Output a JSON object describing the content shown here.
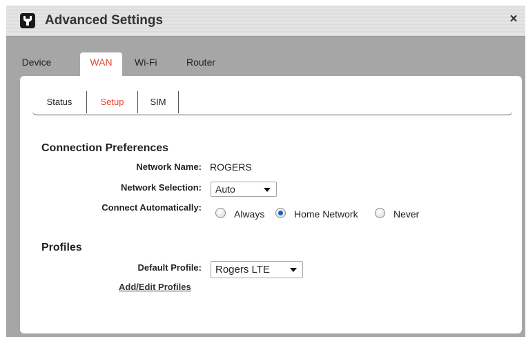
{
  "window": {
    "title": "Advanced Settings",
    "close_symbol": "×",
    "icon": "wrench-icon"
  },
  "main_tabs": [
    {
      "label": "Device",
      "active": false
    },
    {
      "label": "WAN",
      "active": true
    },
    {
      "label": "Wi-Fi",
      "active": false
    },
    {
      "label": "Router",
      "active": false
    }
  ],
  "sub_tabs": [
    {
      "label": "Status",
      "active": false
    },
    {
      "label": "Setup",
      "active": true
    },
    {
      "label": "SIM",
      "active": false
    }
  ],
  "connection_preferences": {
    "title": "Connection Preferences",
    "network_name_label": "Network Name:",
    "network_name_value": "ROGERS",
    "network_selection_label": "Network Selection:",
    "network_selection_value": "Auto",
    "connect_auto_label": "Connect Automatically:",
    "connect_options": [
      {
        "label": "Always",
        "checked": false
      },
      {
        "label": "Home Network",
        "checked": true
      },
      {
        "label": "Never",
        "checked": false
      }
    ]
  },
  "profiles": {
    "title": "Profiles",
    "default_profile_label": "Default Profile:",
    "default_profile_value": "Rogers LTE",
    "add_edit_link": "Add/Edit Profiles"
  },
  "colors": {
    "accent": "#e8472c",
    "radio_selected": "#1560b8",
    "backdrop": "#a6a6a6"
  }
}
